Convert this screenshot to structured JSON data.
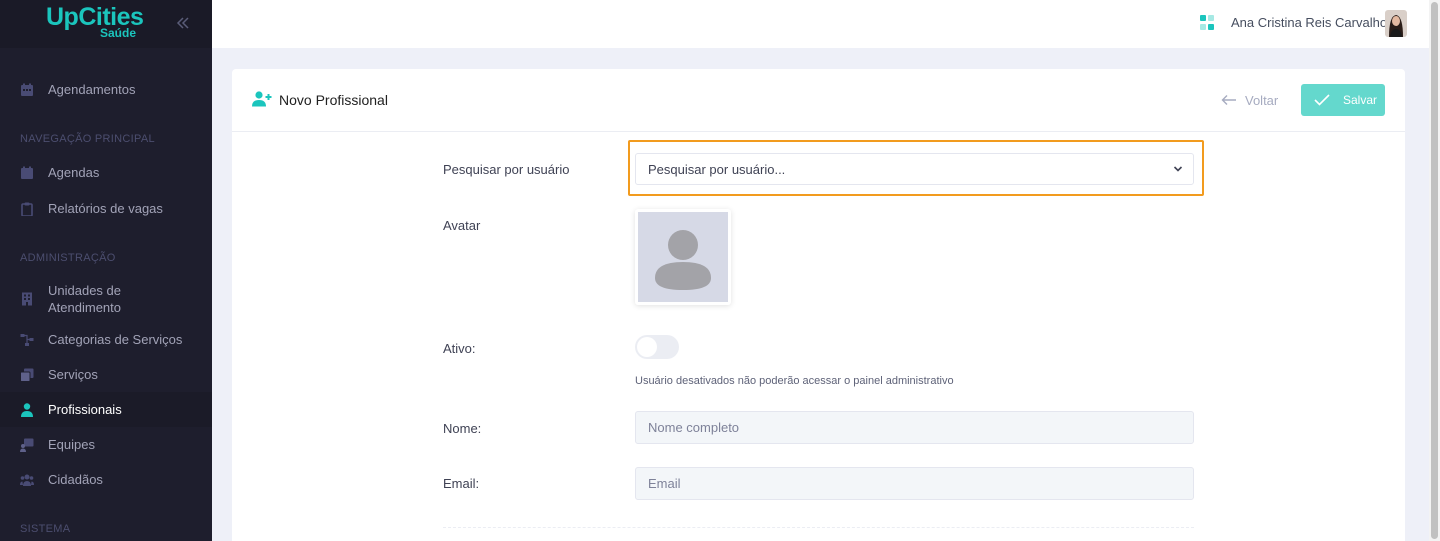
{
  "brand": {
    "logo_main": "UpCities",
    "logo_sub": "Saúde",
    "accent": "#1bc5bd"
  },
  "sidebar": {
    "top_item": {
      "label": "Agendamentos",
      "icon": "calendar-icon"
    },
    "sections": [
      {
        "title": "NAVEGAÇÃO PRINCIPAL",
        "items": [
          {
            "label": "Agendas",
            "icon": "calendar-icon"
          },
          {
            "label": "Relatórios de vagas",
            "icon": "clipboard-icon"
          }
        ]
      },
      {
        "title": "ADMINISTRAÇÃO",
        "items": [
          {
            "label": "Unidades de",
            "label2": "Atendimento",
            "icon": "building-icon"
          },
          {
            "label": "Categorias de Serviços",
            "icon": "sitemap-icon"
          },
          {
            "label": "Serviços",
            "icon": "layers-icon"
          },
          {
            "label": "Profissionais",
            "icon": "user-tie-icon",
            "active": true
          },
          {
            "label": "Equipes",
            "icon": "team-board-icon"
          },
          {
            "label": "Cidadãos",
            "icon": "users-icon"
          }
        ]
      },
      {
        "title": "SISTEMA",
        "items": []
      }
    ]
  },
  "header": {
    "user_name": "Ana Cristina Reis Carvalho"
  },
  "card": {
    "title": "Novo Profissional",
    "back_label": "Voltar",
    "save_label": "Salvar"
  },
  "form": {
    "search": {
      "label": "Pesquisar por usuário",
      "value": "Pesquisar por usuário..."
    },
    "avatar": {
      "label": "Avatar"
    },
    "active": {
      "label": "Ativo:",
      "on": false,
      "help": "Usuário desativados não poderão acessar o painel administrativo"
    },
    "name": {
      "label": "Nome:",
      "placeholder": "Nome completo"
    },
    "email": {
      "label": "Email:",
      "placeholder": "Email"
    }
  },
  "colors": {
    "focus": "#f29b1e",
    "save_button": "#64d8cd",
    "sidebar_bg": "#1e1e2d"
  }
}
